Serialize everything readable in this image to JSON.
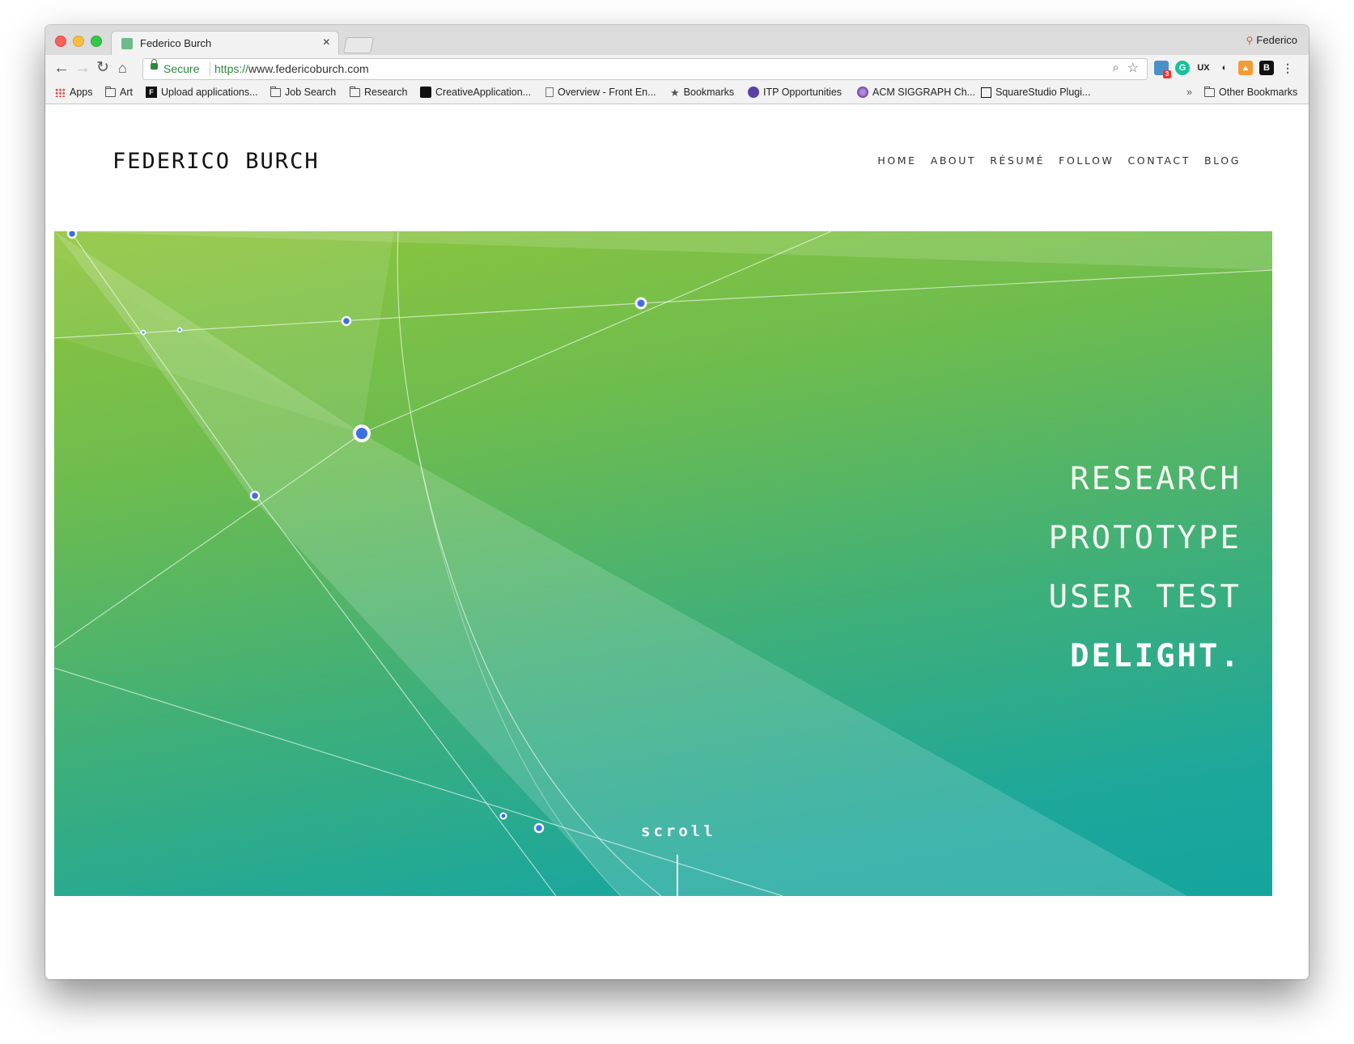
{
  "browser": {
    "tab_title": "Federico Burch",
    "close_glyph": "×",
    "profile_name": "Federico",
    "secure_label": "Secure",
    "url_scheme": "https://",
    "url_host": "www.federicoburch.com",
    "extension_badge": "3",
    "bookmarks": [
      {
        "label": "Apps",
        "icon": "apps-grid-icon"
      },
      {
        "label": "Art",
        "icon": "folder-icon"
      },
      {
        "label": "Upload applications...",
        "icon": "f-logo-icon"
      },
      {
        "label": "Job Search",
        "icon": "folder-icon"
      },
      {
        "label": "Research",
        "icon": "folder-icon"
      },
      {
        "label": "CreativeApplication...",
        "icon": "ca-logo-icon"
      },
      {
        "label": "Overview - Front En...",
        "icon": "doc-icon"
      },
      {
        "label": "Bookmarks",
        "icon": "star-icon"
      },
      {
        "label": "ITP Opportunities",
        "icon": "itp-logo-icon"
      },
      {
        "label": "ACM SIGGRAPH Ch...",
        "icon": "siggraph-icon"
      },
      {
        "label": "SquareStudio Plugi...",
        "icon": "square-icon"
      }
    ],
    "overflow_glyph": "»",
    "other_bookmarks": "Other Bookmarks"
  },
  "site": {
    "brand": "FEDERICO BURCH",
    "nav": [
      "HOME",
      "ABOUT",
      "RÉSUMÉ",
      "FOLLOW",
      "CONTACT",
      "BLOG"
    ],
    "taglines": [
      "RESEARCH",
      "PROTOTYPE",
      "USER TEST",
      "DELIGHT."
    ],
    "scroll_label": "scroll"
  },
  "colors": {
    "hero_top": "#8fc53c",
    "hero_bottom": "#15a59d",
    "node_blue": "#3d6fe0",
    "secure_green": "#2a8b3a"
  }
}
